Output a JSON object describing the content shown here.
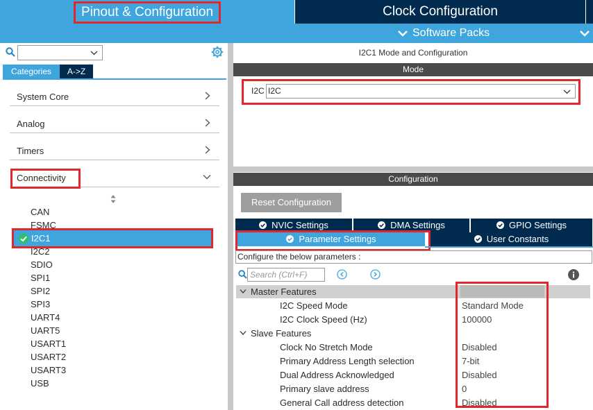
{
  "header": {
    "tab_pinout": "Pinout & Configuration",
    "tab_clock": "Clock Configuration",
    "software_packs": "Software Packs"
  },
  "sidebar": {
    "tabs": {
      "categories": "Categories",
      "az": "A->Z"
    },
    "categories": [
      {
        "label": "System Core"
      },
      {
        "label": "Analog"
      },
      {
        "label": "Timers"
      },
      {
        "label": "Connectivity"
      }
    ],
    "peripherals": [
      "CAN",
      "FSMC",
      "I2C1",
      "I2C2",
      "SDIO",
      "SPI1",
      "SPI2",
      "SPI3",
      "UART4",
      "UART5",
      "USART1",
      "USART2",
      "USART3",
      "USB"
    ],
    "selected": "I2C1"
  },
  "main": {
    "title": "I2C1 Mode and Configuration",
    "mode_header": "Mode",
    "mode_label": "I2C",
    "mode_value": "I2C",
    "config_header": "Configuration",
    "reset_button": "Reset Configuration",
    "tabs_row1": [
      "NVIC Settings",
      "DMA Settings",
      "GPIO Settings"
    ],
    "tabs_row2": [
      "Parameter Settings",
      "User Constants"
    ],
    "config_desc": "Configure the below parameters :",
    "search_placeholder": "Search (Ctrl+F)",
    "groups": {
      "master": "Master Features",
      "slave": "Slave Features"
    },
    "params": [
      {
        "name": "I2C Speed Mode",
        "value": "Standard Mode"
      },
      {
        "name": "I2C Clock Speed (Hz)",
        "value": "100000"
      },
      {
        "name": "Clock No Stretch Mode",
        "value": "Disabled"
      },
      {
        "name": "Primary Address Length selection",
        "value": "7-bit"
      },
      {
        "name": "Dual Address Acknowledged",
        "value": "Disabled"
      },
      {
        "name": "Primary slave address",
        "value": "0"
      },
      {
        "name": "General Call address detection",
        "value": "Disabled"
      }
    ]
  },
  "colors": {
    "accent": "#3ea6dc",
    "dark": "#002b4e",
    "highlight": "#e3262b",
    "check": "#2ebf6b"
  }
}
